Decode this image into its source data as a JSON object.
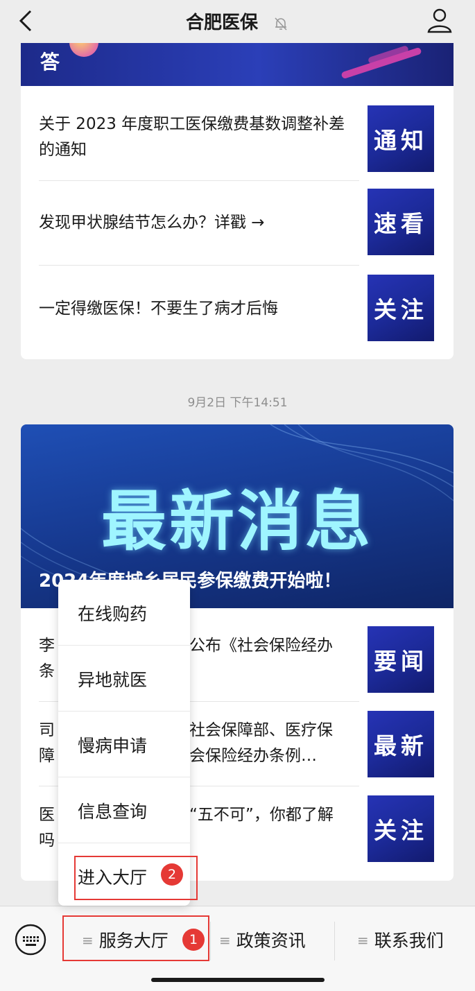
{
  "header": {
    "title": "合肥医保",
    "back_icon": "chevron-left-icon",
    "mute_icon": "bell-off-icon",
    "profile_icon": "user-icon"
  },
  "card1": {
    "banner_char": "答",
    "articles": [
      {
        "text": "关于 2023 年度职工医保缴费基数调整补差的通知",
        "thumb": "通知"
      },
      {
        "text": "发现甲状腺结节怎么办？详戳 →",
        "thumb": "速看"
      },
      {
        "text": "一定得缴医保！不要生了病才后悔",
        "thumb": "关注"
      }
    ]
  },
  "timestamp": "9月2日 下午14:51",
  "card2": {
    "banner_title": "最新消息",
    "banner_subtitle": "2024年度城乡居民参保缴费开始啦！",
    "articles": [
      {
        "text_left": "李",
        "text_left2": "条",
        "text_right": "公布《社会保险经办",
        "thumb": "要闻"
      },
      {
        "text_left": "司",
        "text_left2": "障",
        "text_right": "社会保障部、医疗保",
        "text_right2": "会保险经办条例…",
        "thumb": "最新"
      },
      {
        "text_left": "医",
        "text_left2": "吗",
        "text_right": "“五不可”，你都了解",
        "thumb": "关注"
      }
    ]
  },
  "popup_menu": {
    "items": [
      "在线购药",
      "异地就医",
      "慢病申请",
      "信息查询",
      "进入大厅"
    ],
    "badge": "2"
  },
  "bottom_bar": {
    "keyboard_icon": "keyboard-icon",
    "tabs": [
      "服务大厅",
      "政策资讯",
      "联系我们"
    ],
    "badge": "1"
  },
  "colors": {
    "accent_red": "#e53935",
    "banner_blue": "#1c2a99",
    "background": "#ededed"
  }
}
